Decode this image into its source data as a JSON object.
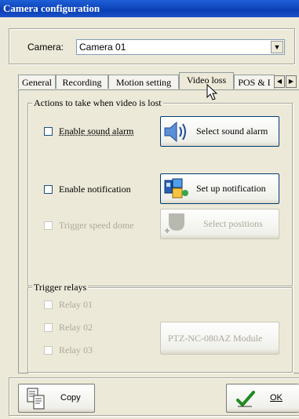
{
  "window": {
    "title": "Camera configuration"
  },
  "camera": {
    "label": "Camera:",
    "selected": "Camera 01"
  },
  "tabs": [
    {
      "label": "General",
      "active": false
    },
    {
      "label": "Recording",
      "active": false
    },
    {
      "label": "Motion setting",
      "active": false
    },
    {
      "label": "Video loss",
      "active": true
    },
    {
      "label": "POS & I",
      "active": false
    }
  ],
  "video_loss_group": {
    "legend": "Actions to take when video is lost",
    "options": [
      {
        "label": "Enable sound alarm",
        "checked": false,
        "enabled": true
      },
      {
        "label": "Enable notification",
        "checked": false,
        "enabled": true
      },
      {
        "label": "Trigger speed dome",
        "checked": false,
        "enabled": false
      }
    ],
    "buttons": {
      "sound": "Select sound alarm",
      "notification": "Set up notification",
      "positions": "Select positions"
    }
  },
  "relays_group": {
    "legend": "Trigger relays",
    "relays": [
      {
        "label": "Relay 01",
        "checked": false,
        "enabled": false
      },
      {
        "label": "Relay 02",
        "checked": false,
        "enabled": false
      },
      {
        "label": "Relay 03",
        "checked": false,
        "enabled": false
      }
    ],
    "module_button": "PTZ-NC-080AZ Module"
  },
  "footer": {
    "copy_label": "Copy",
    "ok_label": "OK"
  },
  "icons": [
    "speaker-icon",
    "notification-icon",
    "positions-icon",
    "copy-icon",
    "checkmark-icon",
    "mouse-cursor-icon"
  ]
}
